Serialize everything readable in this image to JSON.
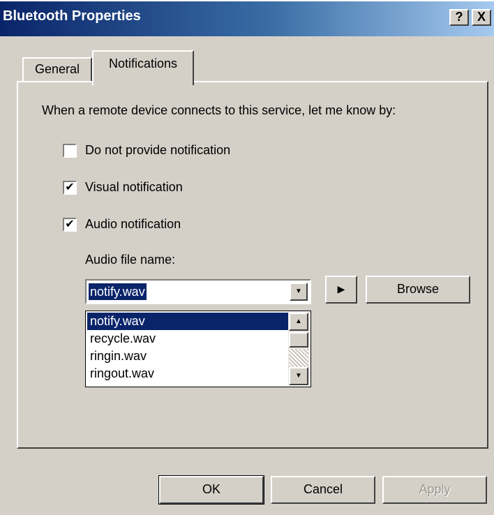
{
  "window": {
    "title": "Bluetooth Properties",
    "help_label": "?",
    "close_label": "X"
  },
  "tabs": [
    {
      "label": "General",
      "selected": false
    },
    {
      "label": "Notifications",
      "selected": true
    }
  ],
  "instruction": "When a remote device connects to this service, let me know by:",
  "options": [
    {
      "label": "Do not provide notification",
      "checked": false,
      "mark": ""
    },
    {
      "label": "Visual notification",
      "checked": true,
      "mark": "✔"
    },
    {
      "label": "Audio notification",
      "checked": true,
      "mark": "✔"
    }
  ],
  "audio": {
    "label": "Audio file name:",
    "selected_file": "notify.wav",
    "files": [
      "notify.wav",
      "recycle.wav",
      "ringin.wav",
      "ringout.wav"
    ],
    "play_icon": "▶",
    "browse_label": "Browse"
  },
  "icons": {
    "combo_arrow": "▼",
    "scroll_up": "▲",
    "scroll_down": "▼"
  },
  "buttons": {
    "ok": "OK",
    "cancel": "Cancel",
    "apply": "Apply"
  },
  "colors": {
    "face": "#d4d0c8",
    "selection": "#0a246a",
    "title_gradient_start": "#0a246a",
    "disabled_text": "#9a978f"
  }
}
